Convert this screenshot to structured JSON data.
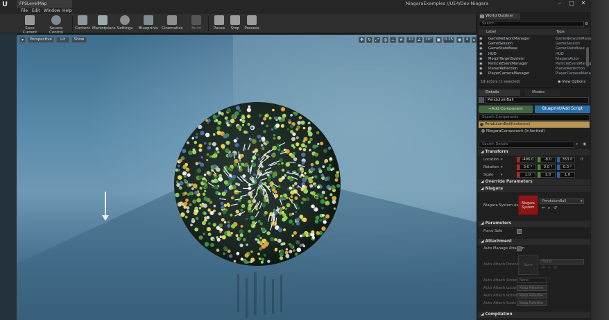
{
  "app": {
    "tab_title": "FPSLevelMap",
    "window_title": "NiagaraExamples //UE4/Dev-Niagara",
    "menus": [
      "File",
      "Edit",
      "Window",
      "Help"
    ]
  },
  "toolbar": {
    "buttons": [
      "Save Current",
      "Source Control",
      "Content",
      "Marketplace",
      "Settings",
      "Blueprints",
      "Cinematics",
      "Build",
      "Pause",
      "Stop",
      "Possess"
    ]
  },
  "viewport": {
    "perspective": "Perspective",
    "lit": "Lit",
    "show": "Show",
    "angle": "10°",
    "scale": "0.25",
    "camera_speed": "4"
  },
  "outliner": {
    "title": "World Outliner",
    "search_placeholder": "Search...",
    "col_label": "Label",
    "col_type": "Type",
    "rows": [
      {
        "label": "GameNetworkManager",
        "type": "GameNetworkManager"
      },
      {
        "label": "GameSession",
        "type": "GameSession"
      },
      {
        "label": "GameStateBase",
        "type": "GameStateBase"
      },
      {
        "label": "HUD",
        "type": "HUD"
      },
      {
        "label": "MorphTargetSystem",
        "type": "NiagaraActor"
      },
      {
        "label": "ParticleEventManager",
        "type": "ParticleEventManager"
      },
      {
        "label": "PlanarReflection",
        "type": "PlanarReflection"
      },
      {
        "label": "PlayerCameraManager",
        "type": "PlayerCameraManager"
      }
    ],
    "footer": "19 actors (1 selected)",
    "view_options": "View Options"
  },
  "details": {
    "tab_details": "Details",
    "tab_modes": "Modes",
    "actor_name": "PendulumBall",
    "add_component": "+Add Component",
    "blueprint_button": "Blueprint/Add Script",
    "search_components": "Search Components",
    "components": [
      "PendulumBall(Instance)",
      "NiagaraComponent (Inherited)"
    ],
    "search_details": "Search Details",
    "transform": {
      "title": "Transform",
      "location_label": "Location",
      "rotation_label": "Rotation",
      "scale_label": "Scale",
      "location": [
        "-496.0",
        "-8.0",
        "353.0"
      ],
      "rotation": [
        "0.0 °",
        "0.0 °",
        "0.0 °"
      ],
      "scale": [
        "1.0",
        "1.0",
        "1.0"
      ]
    },
    "override_title": "Override Parameters",
    "niagara": {
      "title": "Niagara",
      "asset_label": "Niagara System Asset",
      "thumb_label": "Niagara System",
      "asset_value": "PendulumBall"
    },
    "parameters": {
      "title": "Parameters",
      "force_solo": "Force Solo"
    },
    "attachment": {
      "title": "Attachment",
      "auto_manage": "Auto Manage Attachm",
      "auto_parent": "Auto Attach Parent",
      "none_thumb": "None",
      "none_value": "None",
      "socket_name_label": "Auto Attach Socket N",
      "socket_name_value": "None",
      "location_rule_label": "Auto Attach Location",
      "rotation_rule_label": "Auto Attach Rotation",
      "scale_rule_label": "Auto Attach Scale Rul",
      "keep_relative": "Keep Relative"
    },
    "compilation_title": "Compilation"
  },
  "colors": {
    "accent_blue": "#2a6fa8",
    "niagara_thumb": "#8b1616",
    "x_red": "#b3261e",
    "y_green": "#4f8a2b",
    "z_blue": "#2e5fa8"
  }
}
